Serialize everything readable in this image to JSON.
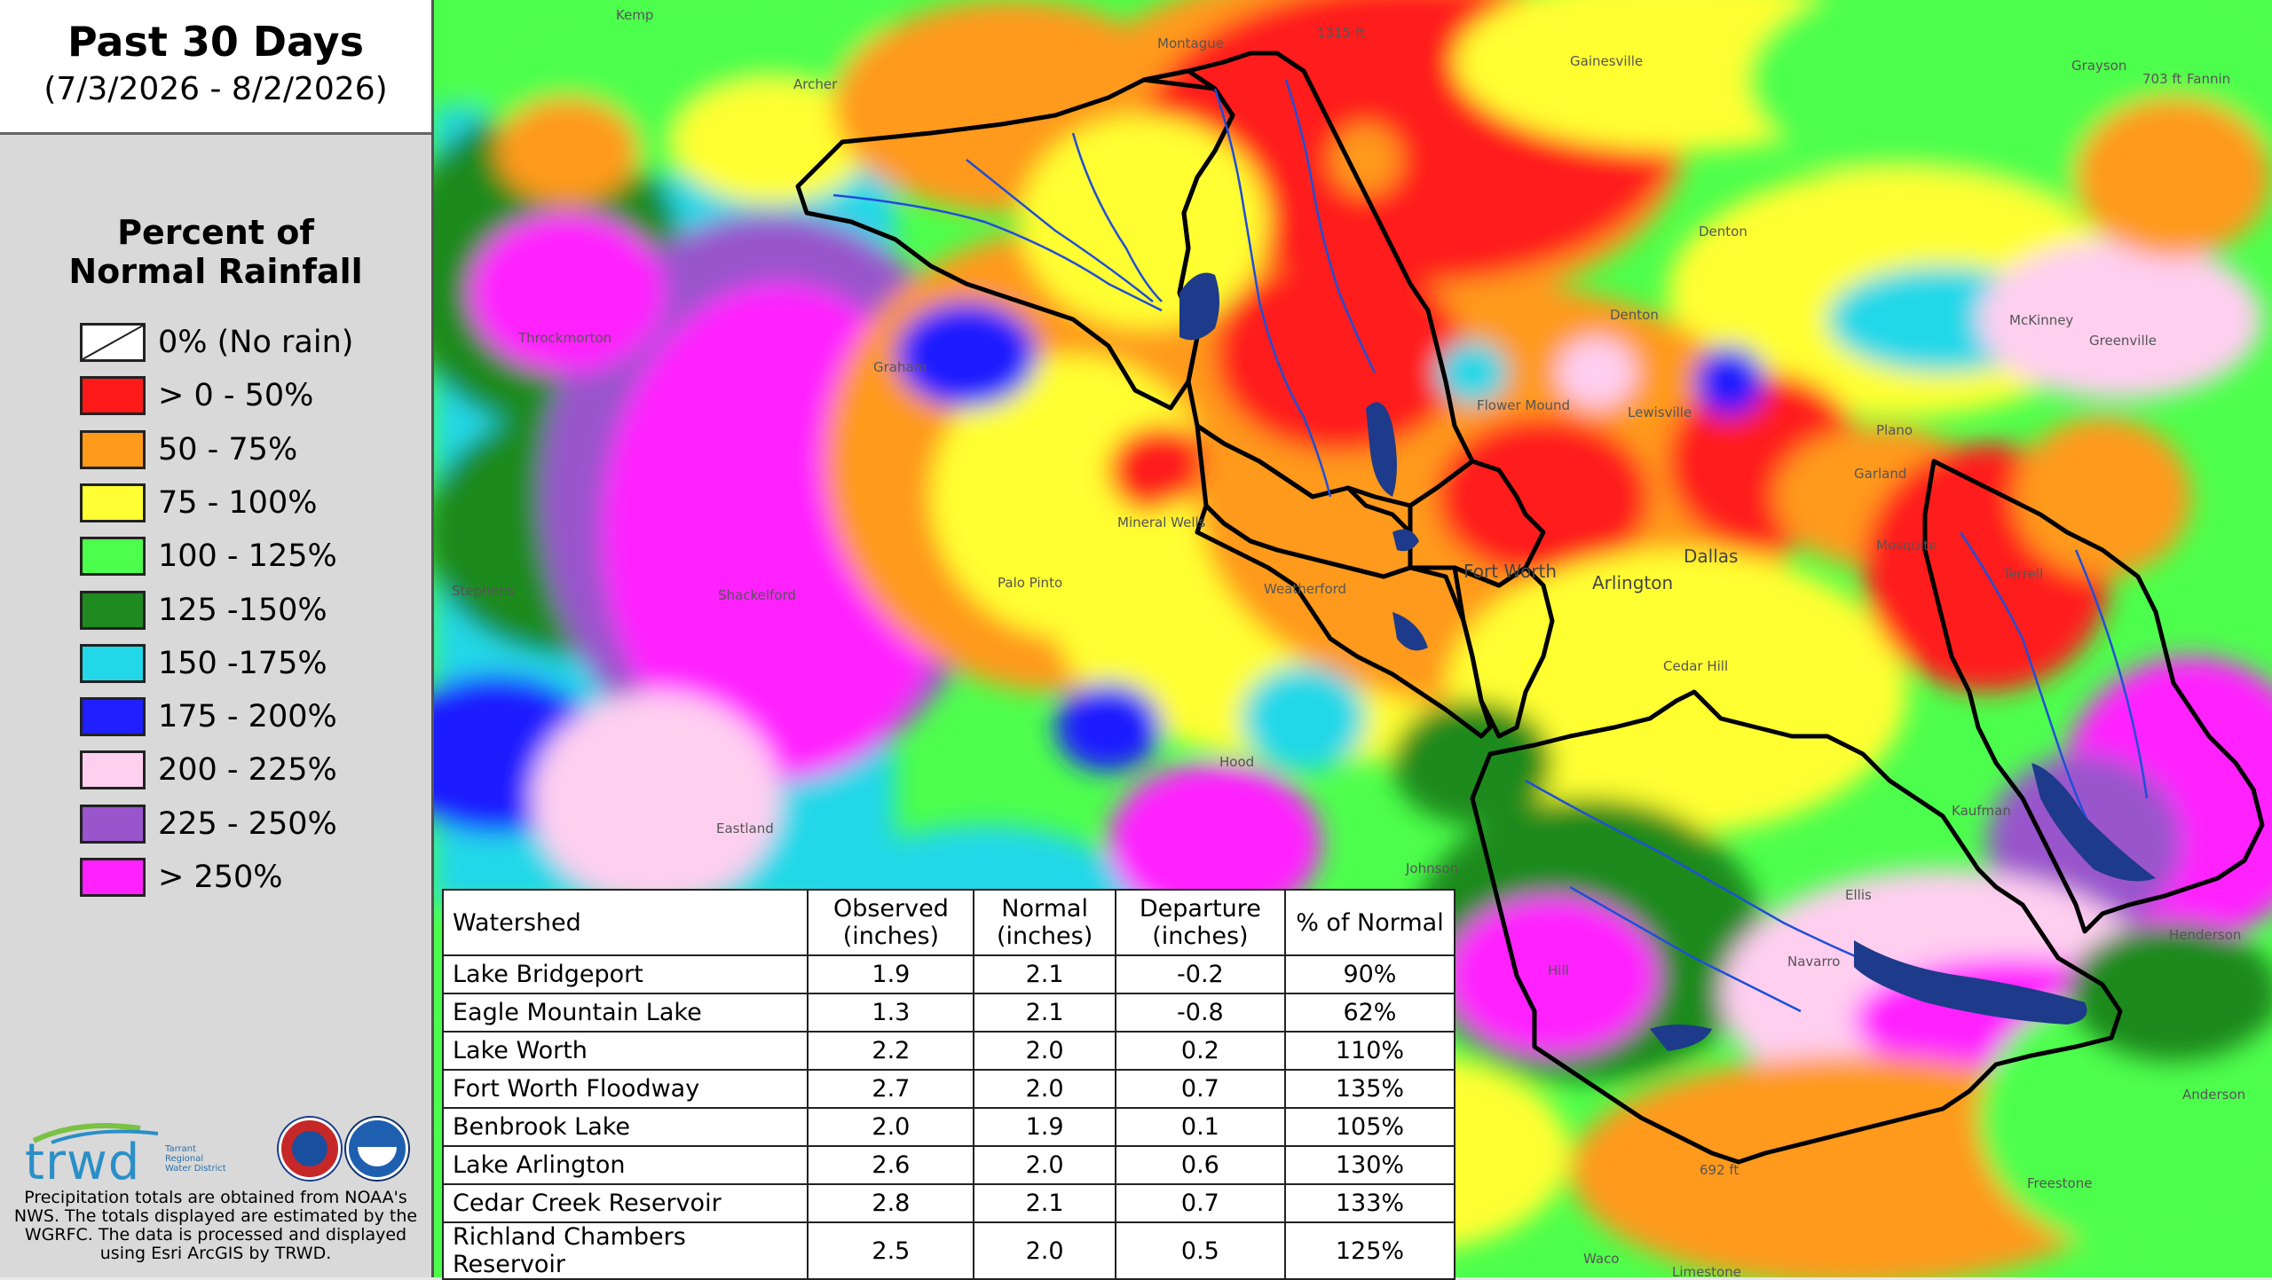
{
  "title": {
    "main": "Past 30 Days",
    "range": "(7/3/2026 - 8/2/2026)"
  },
  "legend": {
    "title_line1": "Percent of",
    "title_line2": "Normal Rainfall",
    "items": [
      {
        "label": "0% (No rain)",
        "color": "#ffffff"
      },
      {
        "label": "> 0 - 50%",
        "color": "#ff1a1a"
      },
      {
        "label": "50 - 75%",
        "color": "#ff9a1a"
      },
      {
        "label": "75 - 100%",
        "color": "#ffff33"
      },
      {
        "label": "100 - 125%",
        "color": "#4dff4d"
      },
      {
        "label": "125 -150%",
        "color": "#1f8a1f"
      },
      {
        "label": "150 -175%",
        "color": "#22d8e8"
      },
      {
        "label": "175 - 200%",
        "color": "#1f1fff"
      },
      {
        "label": "200 - 225%",
        "color": "#ffcff0"
      },
      {
        "label": "225 - 250%",
        "color": "#9955cc"
      },
      {
        "label": "> 250%",
        "color": "#ff22ff"
      }
    ]
  },
  "logos": {
    "trwd": "trwd",
    "trwd_sub": "Tarrant Regional Water District",
    "nws_icon": "nws-logo-icon",
    "noaa_icon": "noaa-logo-icon"
  },
  "footnote": "Precipitation totals are obtained from NOAA's NWS. The totals displayed are estimated by the WGRFC. The data is processed and displayed using Esri ArcGIS by TRWD.",
  "map_places": [
    "Kemp",
    "1315 ft",
    "Montague",
    "Gainesville",
    "Grayson",
    "703 ft",
    "Fannin",
    "Archer",
    "Denton",
    "Throckmorton",
    "Graham",
    "McKinney",
    "Greenville",
    "Denton",
    "Flower Mound",
    "Lewisville",
    "Plano",
    "Garland",
    "Mineral Wells",
    "Fort Worth",
    "Dallas",
    "Mesquite",
    "Weatherford",
    "Arlington",
    "Terrell",
    "Stephens",
    "Shackelford",
    "Palo Pinto",
    "Cedar Hill",
    "Hood",
    "Eastland",
    "Johnson",
    "Hill",
    "Navarro",
    "692 ft",
    "Freestone",
    "Anderson",
    "Limestone",
    "Waco",
    "Henderson",
    "Ellis",
    "Kaufman"
  ],
  "table": {
    "headers": {
      "watershed": "Watershed",
      "observed": "Observed (inches)",
      "normal": "Normal (inches)",
      "departure": "Departure (inches)",
      "pct": "% of Normal"
    },
    "rows": [
      {
        "name": "Lake Bridgeport",
        "observed": "1.9",
        "normal": "2.1",
        "departure": "-0.2",
        "pct": "90%"
      },
      {
        "name": "Eagle Mountain Lake",
        "observed": "1.3",
        "normal": "2.1",
        "departure": "-0.8",
        "pct": "62%"
      },
      {
        "name": "Lake Worth",
        "observed": "2.2",
        "normal": "2.0",
        "departure": "0.2",
        "pct": "110%"
      },
      {
        "name": "Fort Worth Floodway",
        "observed": "2.7",
        "normal": "2.0",
        "departure": "0.7",
        "pct": "135%"
      },
      {
        "name": "Benbrook Lake",
        "observed": "2.0",
        "normal": "1.9",
        "departure": "0.1",
        "pct": "105%"
      },
      {
        "name": "Lake Arlington",
        "observed": "2.6",
        "normal": "2.0",
        "departure": "0.6",
        "pct": "130%"
      },
      {
        "name": "Cedar Creek Reservoir",
        "observed": "2.8",
        "normal": "2.1",
        "departure": "0.7",
        "pct": "133%"
      },
      {
        "name": "Richland Chambers Reservoir",
        "observed": "2.5",
        "normal": "2.0",
        "departure": "0.5",
        "pct": "125%"
      }
    ]
  }
}
